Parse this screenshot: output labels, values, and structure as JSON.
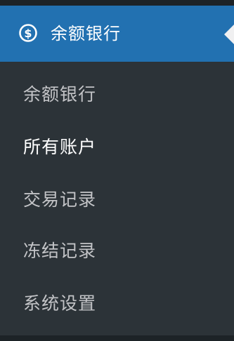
{
  "menu": {
    "title": "余额银行",
    "icon": "dollar-circle-icon",
    "colors": {
      "header_bg": "#2271b1",
      "submenu_bg": "#2c3338",
      "item_text": "#c3c4c7",
      "current_text": "#ffffff"
    },
    "items": [
      {
        "label": "余额银行",
        "current": false
      },
      {
        "label": "所有账户",
        "current": true
      },
      {
        "label": "交易记录",
        "current": false
      },
      {
        "label": "冻结记录",
        "current": false
      },
      {
        "label": "系统设置",
        "current": false
      }
    ]
  }
}
